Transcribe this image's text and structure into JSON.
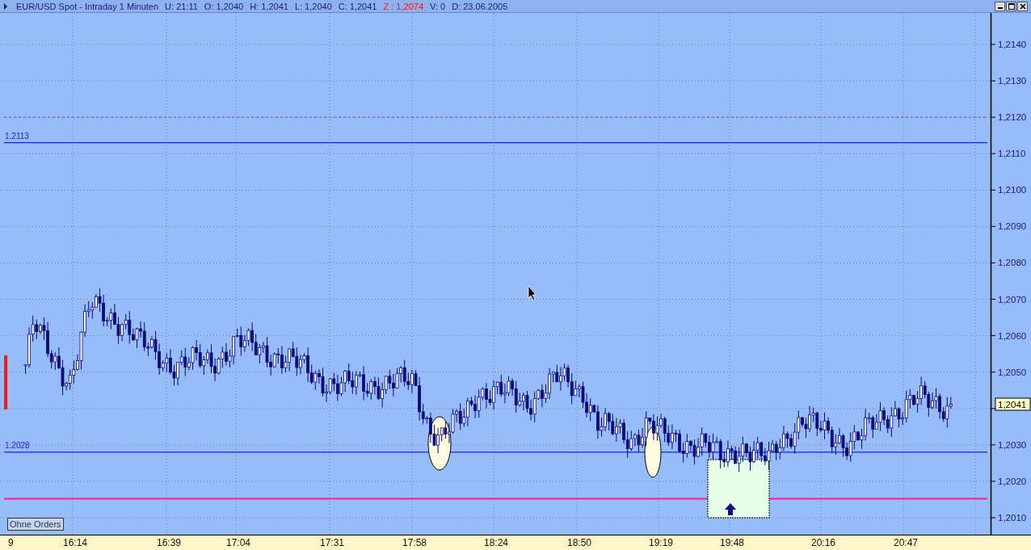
{
  "window": {
    "title": "EUR/USD Spot - Intraday 1 Minuten",
    "fields": [
      {
        "label": "U:",
        "value": "21:11",
        "kind": "plain"
      },
      {
        "label": "O:",
        "value": "1,2040",
        "kind": "plain"
      },
      {
        "label": "H:",
        "value": "1,2041",
        "kind": "plain"
      },
      {
        "label": "L:",
        "value": "1,2040",
        "kind": "plain"
      },
      {
        "label": "C:",
        "value": "1,2041",
        "kind": "plain"
      },
      {
        "label": "Z :",
        "value": "1,2074",
        "kind": "alert"
      },
      {
        "label": "V:",
        "value": "0",
        "kind": "plain"
      },
      {
        "label": "D:",
        "value": "23.06.2005",
        "kind": "plain"
      }
    ]
  },
  "price_axis": {
    "labels": [
      "1,2140",
      "1,2130",
      "1,2120",
      "1,2110",
      "1,2100",
      "1,2090",
      "1,2080",
      "1,2070",
      "1,2060",
      "1,2050",
      "1,2030",
      "1,2020",
      "1,2010"
    ],
    "current_price": "1,2041"
  },
  "level_lines": [
    {
      "label": "1.2113"
    },
    {
      "label": "1.2028"
    }
  ],
  "time_axis": {
    "labels": [
      "9",
      "16:14",
      "16:39",
      "17:04",
      "17:31",
      "17:58",
      "18:24",
      "18:50",
      "19:19",
      "19:48",
      "20:16",
      "20:47"
    ]
  },
  "orders_button": {
    "label": "Ohne Orders"
  }
}
